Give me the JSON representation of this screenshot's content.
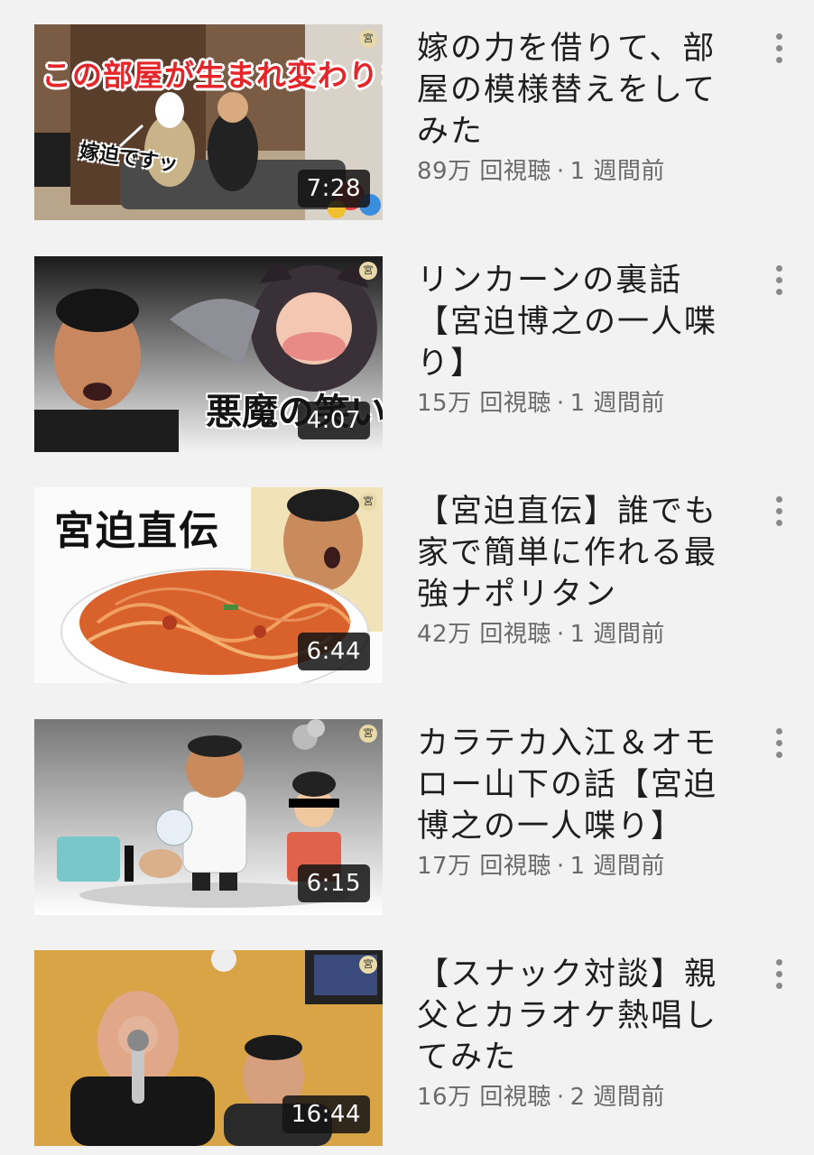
{
  "videos": [
    {
      "title": "嫁の力を借りて、部屋の模様替えをしてみた",
      "views": "89万 回視聴",
      "age": "1 週間前",
      "duration": "7:28",
      "channel_badge": "宮",
      "thumb_banner": "この部屋が生まれ変わります",
      "thumb_label": "嫁迫ですッ",
      "thumb_icon": "house-interior-thumbnail"
    },
    {
      "title": "リンカーンの裏話【宮迫博之の一人喋り】",
      "views": "15万 回視聴",
      "age": "1 週間前",
      "duration": "4:07",
      "channel_badge": "宮",
      "thumb_text": "悪魔の笑い声",
      "thumb_icon": "devil-illustration-thumbnail"
    },
    {
      "title": "【宮迫直伝】誰でも家で簡単に作れる最強ナポリタン",
      "views": "42万 回視聴",
      "age": "1 週間前",
      "duration": "6:44",
      "channel_badge": "宮",
      "thumb_text": "宮迫直伝",
      "thumb_icon": "napolitan-pasta-thumbnail"
    },
    {
      "title": "カラテカ入江＆オモロー山下の話【宮迫博之の一人喋り】",
      "views": "17万 回視聴",
      "age": "1 週間前",
      "duration": "6:15",
      "channel_badge": "宮",
      "thumb_icon": "robot-scientist-illustration-thumbnail"
    },
    {
      "title": "【スナック対談】親父とカラオケ熱唱してみた",
      "views": "16万 回視聴",
      "age": "2 週間前",
      "duration": "16:44",
      "channel_badge": "宮",
      "thumb_icon": "karaoke-bar-thumbnail"
    }
  ],
  "meta_separator": "·",
  "colors": {
    "background": "#f2f2f2",
    "title": "#1e1e1e",
    "meta": "#6a6a6a",
    "duration_bg": "#141414",
    "menu_dots": "#8a8a8a"
  }
}
